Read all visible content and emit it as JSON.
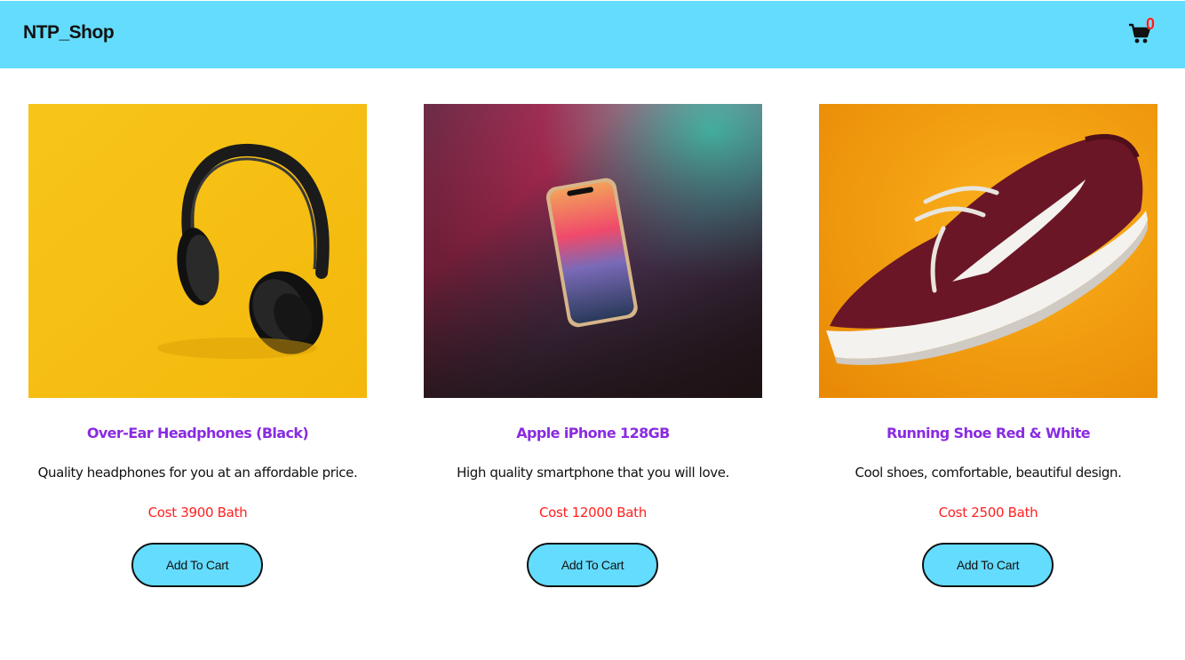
{
  "navbar": {
    "brand": "NTP_Shop",
    "cart_icon": "shopping-cart-icon",
    "cart_count": "0",
    "background_color": "#64dcfe",
    "badge_color": "#ff1a1a"
  },
  "products": [
    {
      "image": "headphones-photo",
      "title": "Over-Ear Headphones (Black)",
      "description": "Quality headphones for you at an affordable price.",
      "price": "Cost 3900 Bath",
      "button_label": "Add To Cart"
    },
    {
      "image": "smartphone-photo",
      "title": "Apple iPhone 128GB",
      "description": "High quality smartphone that you will love.",
      "price": "Cost 12000 Bath",
      "button_label": "Add To Cart"
    },
    {
      "image": "sneaker-photo",
      "title": "Running Shoe Red & White",
      "description": "Cool shoes, comfortable, beautiful design.",
      "price": "Cost 2500 Bath",
      "button_label": "Add To Cart"
    }
  ],
  "colors": {
    "title": "#8a2be2",
    "price": "#ff2020",
    "button": "#64dcfe"
  }
}
